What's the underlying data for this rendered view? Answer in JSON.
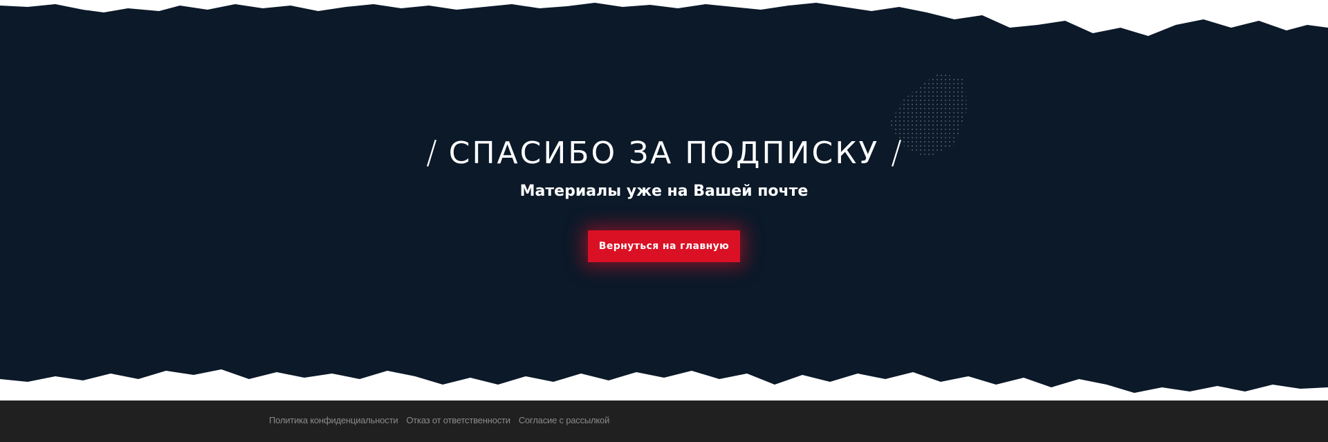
{
  "hero": {
    "title": "СПАСИБО ЗА ПОДПИСКУ",
    "title_slash_left": "/",
    "title_slash_right": "/",
    "subtitle": "Материалы уже на Вашей почте",
    "button_label": "Вернуться на главную"
  },
  "footer": {
    "links": [
      "Политика конфиденциальности",
      "Отказ от ответственности",
      "Согласие с рассылкой"
    ]
  },
  "colors": {
    "hero_background": "#0b1929",
    "accent": "#da1125",
    "footer_background": "#202020",
    "footer_link": "#8a8a8a",
    "page_background": "#ffffff"
  }
}
